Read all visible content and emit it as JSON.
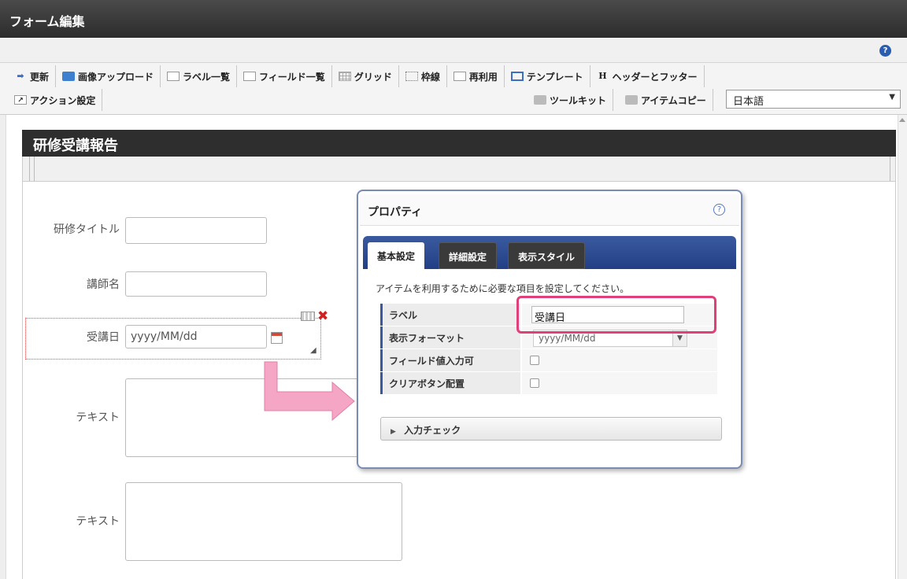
{
  "window": {
    "title": "フォーム編集"
  },
  "help": {
    "icon": "question-circle-icon",
    "glyph": "?"
  },
  "toolbar": {
    "row1": [
      {
        "label": "更新",
        "icon": "update-icon"
      },
      {
        "label": "画像アップロード",
        "icon": "image-upload-icon"
      },
      {
        "label": "ラベル一覧",
        "icon": "label-list-icon"
      },
      {
        "label": "フィールド一覧",
        "icon": "field-list-icon"
      },
      {
        "label": "グリッド",
        "icon": "grid-icon"
      },
      {
        "label": "枠線",
        "icon": "border-icon"
      },
      {
        "label": "再利用",
        "icon": "reuse-icon"
      },
      {
        "label": "テンプレート",
        "icon": "template-icon"
      },
      {
        "label": "ヘッダーとフッター",
        "icon": "header-footer-icon",
        "glyph": "H"
      }
    ],
    "row2_left": {
      "label": "アクション設定",
      "icon": "action-icon"
    },
    "toolkit": {
      "label": "ツールキット",
      "icon": "toolkit-icon"
    },
    "item_copy": {
      "label": "アイテムコピー",
      "icon": "item-copy-icon"
    },
    "language": {
      "value": "日本語",
      "arrow": "▼"
    }
  },
  "form": {
    "title": "研修受講報告",
    "fields": {
      "training_title": {
        "label": "研修タイトル"
      },
      "instructor": {
        "label": "講師名"
      },
      "date": {
        "label": "受講日",
        "value": "yyyy/MM/dd"
      },
      "text1": {
        "label": "テキスト"
      },
      "text2": {
        "label": "テキスト"
      }
    },
    "resize_glyph": "◢",
    "delete_glyph": "✖"
  },
  "properties": {
    "title": "プロパティ",
    "help_glyph": "?",
    "tabs": [
      "基本設定",
      "詳細設定",
      "表示スタイル"
    ],
    "description": "アイテムを利用するために必要な項目を設定してください。",
    "rows": {
      "label": {
        "name": "ラベル",
        "value": "受講日"
      },
      "format": {
        "name": "表示フォーマット",
        "value": "yyyy/MM/dd",
        "arrow": "▼"
      },
      "field_input": {
        "name": "フィールド値入力可",
        "checked": false
      },
      "clear_button": {
        "name": "クリアボタン配置",
        "checked": false
      }
    },
    "input_check": {
      "label": "入力チェック",
      "arrow": "▶"
    }
  },
  "colors": {
    "highlight": "#e0407a",
    "tab_bar": "#2b4a90",
    "titlebar": "#333333",
    "arrow": "#f4a6c4"
  }
}
